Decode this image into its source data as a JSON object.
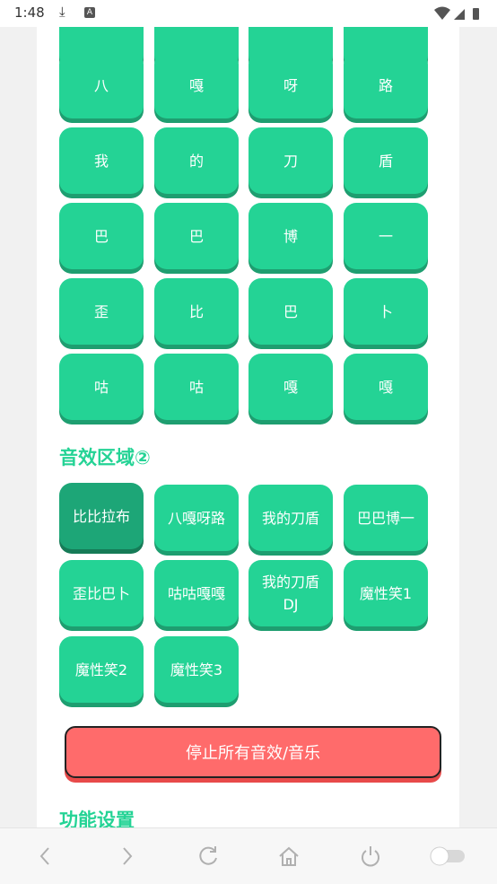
{
  "status_bar": {
    "time": "1:48",
    "download_icon": "download-icon",
    "a_badge": "A"
  },
  "grid1": {
    "rows": [
      [
        "",
        "",
        "",
        ""
      ],
      [
        "八",
        "嘎",
        "呀",
        "路"
      ],
      [
        "我",
        "的",
        "刀",
        "盾"
      ],
      [
        "巴",
        "巴",
        "博",
        "一"
      ],
      [
        "歪",
        "比",
        "巴",
        "卜"
      ],
      [
        "咕",
        "咕",
        "嘎",
        "嘎"
      ]
    ]
  },
  "section2": {
    "title": "音效区域②",
    "pads": [
      "比比拉布",
      "八嘎呀路",
      "我的刀盾",
      "巴巴博一",
      "歪比巴卜",
      "咕咕嘎嘎",
      "我的刀盾DJ",
      "魔性笑1",
      "魔性笑2",
      "魔性笑3"
    ]
  },
  "stop_button": {
    "label": "停止所有音效/音乐"
  },
  "section3": {
    "title": "功能设置"
  },
  "browser_nav": {
    "icons": [
      "back-icon",
      "forward-icon",
      "refresh-icon",
      "home-icon",
      "power-icon",
      "toggle-icon"
    ]
  },
  "colors": {
    "pad": "#24d395",
    "pad_shadow": "#1e9e70",
    "pad_active": "#1da677",
    "stop": "#ff6b6b",
    "title": "#24d395"
  }
}
